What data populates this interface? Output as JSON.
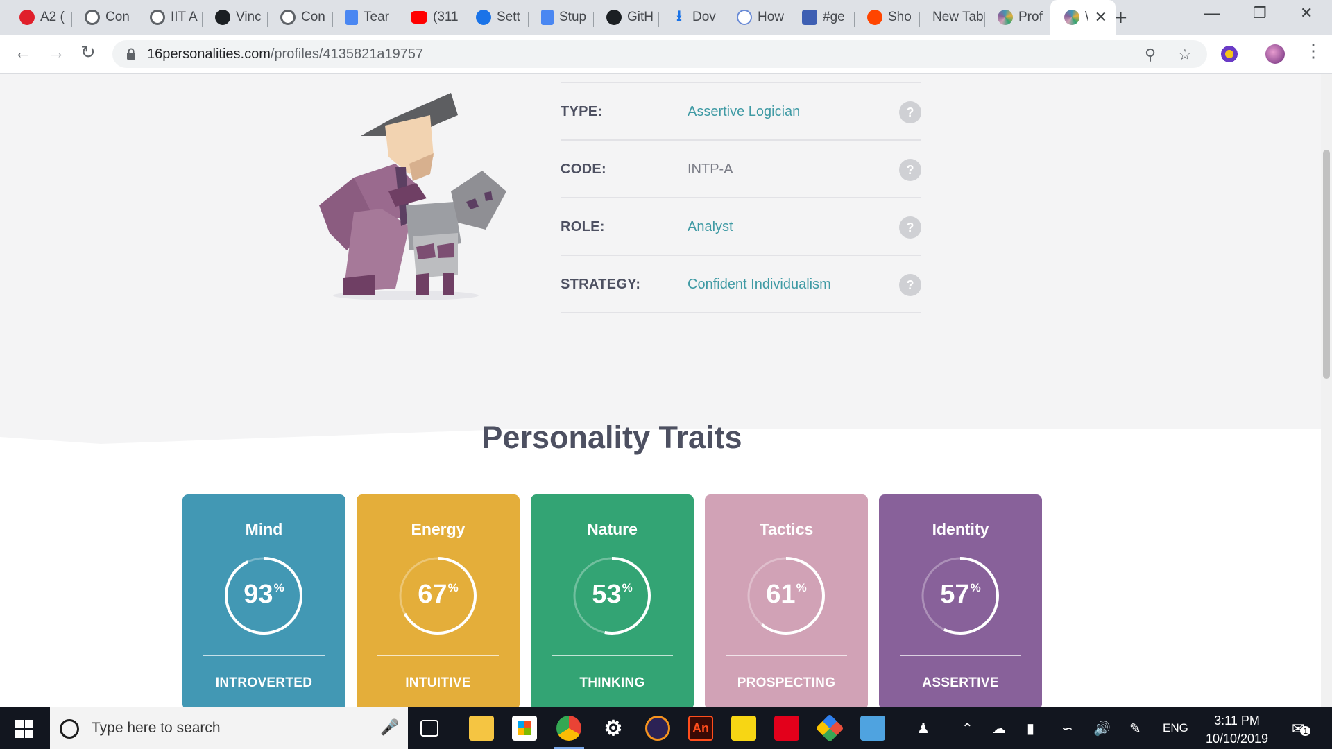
{
  "browser": {
    "tabs": [
      {
        "title": "A2 (",
        "icon": "red-dot-icon"
      },
      {
        "title": "Con",
        "icon": "globe-icon"
      },
      {
        "title": "IIT A",
        "icon": "globe-icon"
      },
      {
        "title": "Vinc",
        "icon": "github-icon"
      },
      {
        "title": "Con",
        "icon": "globe-icon"
      },
      {
        "title": "Tear",
        "icon": "docs-icon"
      },
      {
        "title": "(311",
        "icon": "youtube-icon"
      },
      {
        "title": "Sett",
        "icon": "gear-icon"
      },
      {
        "title": "Stup",
        "icon": "docs-icon"
      },
      {
        "title": "GitH",
        "icon": "github-icon"
      },
      {
        "title": "Dov",
        "icon": "download-icon"
      },
      {
        "title": "How",
        "icon": "brain-icon"
      },
      {
        "title": "#ge",
        "icon": "chat-icon"
      },
      {
        "title": "Sho",
        "icon": "reddit-icon"
      },
      {
        "title": "New Tab",
        "icon": ""
      },
      {
        "title": "Prof",
        "icon": "16p-icon"
      },
      {
        "title": "\\",
        "icon": "16p-icon"
      }
    ],
    "url_host": "16personalities.com",
    "url_path": "/profiles/4135821a19757"
  },
  "profile": {
    "rows": [
      {
        "label": "TYPE:",
        "value": "Assertive Logician",
        "link": true
      },
      {
        "label": "CODE:",
        "value": "INTP-A",
        "link": false
      },
      {
        "label": "ROLE:",
        "value": "Analyst",
        "link": true
      },
      {
        "label": "STRATEGY:",
        "value": "Confident Individualism",
        "link": true
      }
    ],
    "help_glyph": "?"
  },
  "traits": {
    "title": "Personality Traits",
    "percent_sign": "%",
    "cards": [
      {
        "name": "Mind",
        "percent": 93,
        "trait": "INTROVERTED",
        "color": "#4298b4"
      },
      {
        "name": "Energy",
        "percent": 67,
        "trait": "INTUITIVE",
        "color": "#e4ae3a"
      },
      {
        "name": "Nature",
        "percent": 53,
        "trait": "THINKING",
        "color": "#33a474"
      },
      {
        "name": "Tactics",
        "percent": 61,
        "trait": "PROSPECTING",
        "color": "#d1a2b6"
      },
      {
        "name": "Identity",
        "percent": 57,
        "trait": "ASSERTIVE",
        "color": "#88619a"
      }
    ]
  },
  "taskbar": {
    "search_placeholder": "Type here to search",
    "lang": "ENG",
    "time": "3:11 PM",
    "date": "10/10/2019",
    "notification_count": "1",
    "an_label": "An"
  }
}
